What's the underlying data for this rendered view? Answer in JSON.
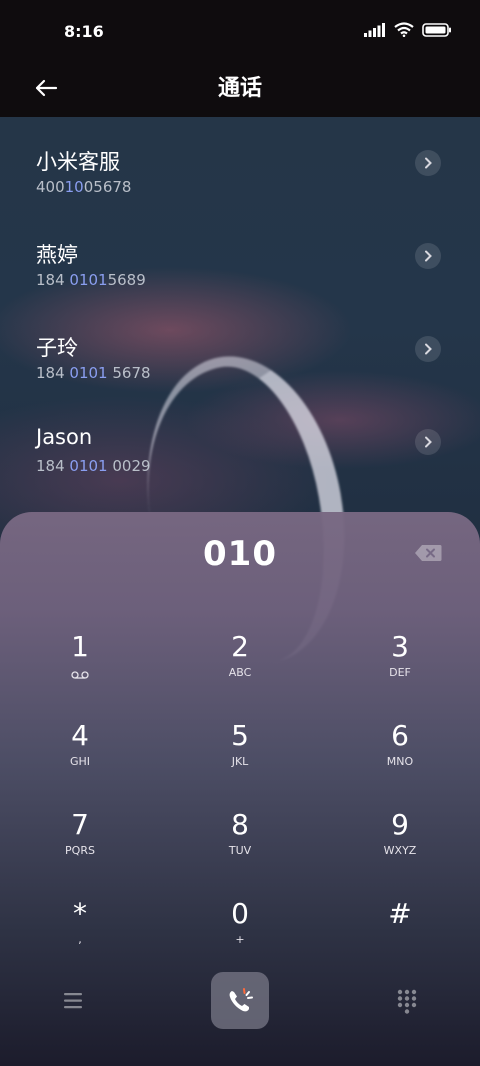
{
  "status": {
    "time": "8:16"
  },
  "header": {
    "title": "通话"
  },
  "contacts": [
    {
      "name": "小米客服",
      "number_prefix": "400",
      "number_match": "10",
      "number_suffix": "05678"
    },
    {
      "name": "燕婷",
      "number_prefix": "184 ",
      "number_match": "0101",
      "number_suffix": "5689"
    },
    {
      "name": "子玲",
      "number_prefix": "184 ",
      "number_match": "0101",
      "number_suffix": " 5678"
    },
    {
      "name": "Jason",
      "number_prefix": "184 ",
      "number_match": "0101",
      "number_suffix": " 0029"
    }
  ],
  "dialer": {
    "entered": "010",
    "keys": [
      {
        "digit": "1",
        "letters": ""
      },
      {
        "digit": "2",
        "letters": "ABC"
      },
      {
        "digit": "3",
        "letters": "DEF"
      },
      {
        "digit": "4",
        "letters": "GHI"
      },
      {
        "digit": "5",
        "letters": "JKL"
      },
      {
        "digit": "6",
        "letters": "MNO"
      },
      {
        "digit": "7",
        "letters": "PQRS"
      },
      {
        "digit": "8",
        "letters": "TUV"
      },
      {
        "digit": "9",
        "letters": "WXYZ"
      },
      {
        "digit": "*",
        "letters": ","
      },
      {
        "digit": "0",
        "letters": "+"
      },
      {
        "digit": "#",
        "letters": ""
      }
    ]
  },
  "colors": {
    "match_highlight": "#8a9ef0",
    "header_bg": "#0f0c0e"
  },
  "icons": {
    "voicemail": "voicemail-icon",
    "call": "call-icon",
    "menu": "menu-icon",
    "dialpad": "dialpad-icon"
  }
}
